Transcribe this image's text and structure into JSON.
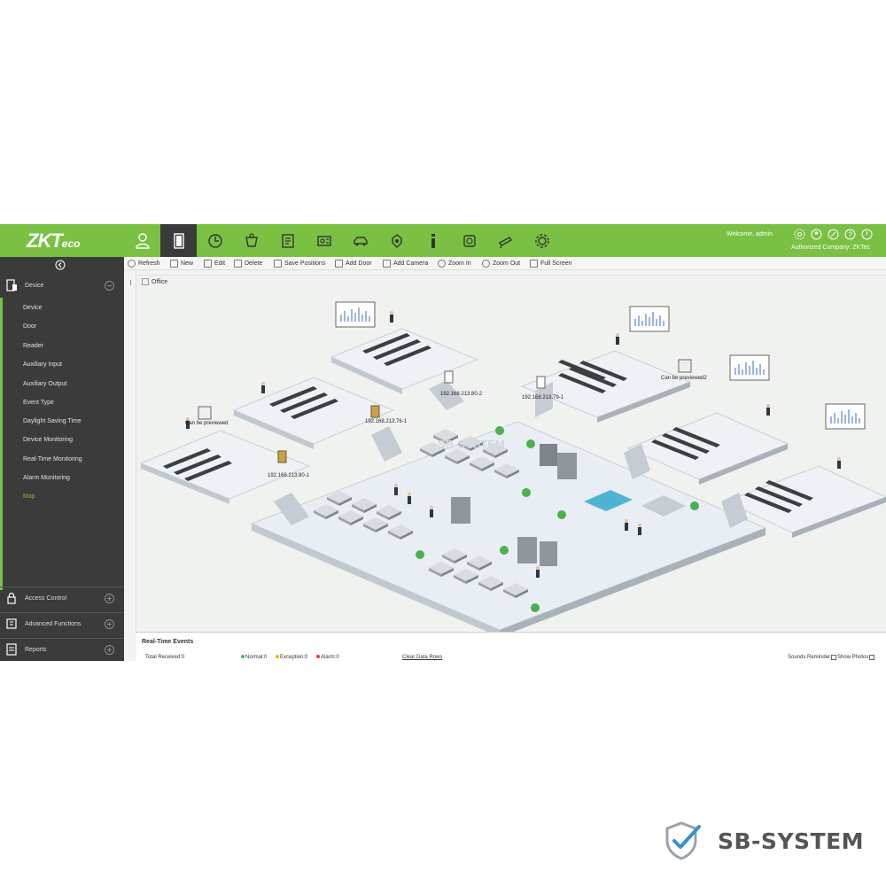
{
  "brand": {
    "logo_main": "ZKT",
    "logo_tail": "eco"
  },
  "header": {
    "welcome": "Welcome, admin",
    "company": "Authorized Company: ZKTec"
  },
  "toolbar": {
    "refresh": "Refresh",
    "new": "New",
    "edit": "Edit",
    "delete": "Delete",
    "save_positions": "Save Positions",
    "add_door": "Add Door",
    "add_camera": "Add Camera",
    "zoom_in": "Zoom In",
    "zoom_out": "Zoom Out",
    "full_screen": "Full Screen"
  },
  "sidebar": {
    "device_group": "Device",
    "items": [
      "Device",
      "Door",
      "Reader",
      "Auxiliary Input",
      "Auxiliary Output",
      "Event Type",
      "Daylight Saving Time",
      "Device Monitoring",
      "Real-Time Monitoring",
      "Alarm Monitoring",
      "Map"
    ],
    "active_item": "Map",
    "access_control": "Access Control",
    "advanced_functions": "Advanced Functions",
    "reports": "Reports"
  },
  "map": {
    "title": "Office",
    "labels": {
      "door1": "192.168.213.80-2",
      "door2": "192.168.213.79-1",
      "door3": "192.168.213.76-1",
      "door4": "192.168.213.80-1",
      "cam1": "Can be previewed",
      "cam2": "Can be previewed2",
      "watermark": "SB-SYSTEM"
    }
  },
  "events": {
    "title": "Real-Time Events",
    "total": "Total Received:0",
    "normal": "Normal:0",
    "exception": "Exception:0",
    "alarm": "Alarm:0",
    "clear": "Clear Data Rows",
    "sounds": "Sounds Reminder",
    "show_photos": "Show Photos"
  },
  "colors": {
    "accent": "#7ac143",
    "sidebar": "#3b3b3b",
    "normal": "#4caf50",
    "exception": "#f0b400",
    "alarm": "#e53935"
  },
  "footer_brand": "SB-SYSTEM"
}
